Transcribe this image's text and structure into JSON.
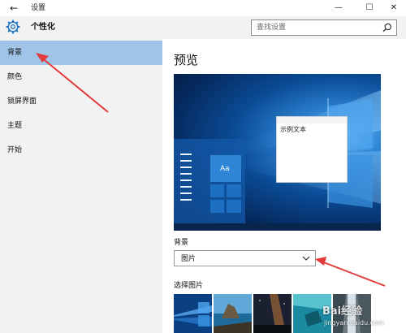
{
  "window": {
    "back_glyph": "←",
    "title": "设置",
    "minimize_glyph": "—",
    "maximize_glyph": "☐",
    "close_glyph": "✕"
  },
  "header": {
    "icon": "gear-icon",
    "title": "个性化",
    "search_placeholder": "查找设置",
    "search_icon": "search-icon"
  },
  "sidebar": {
    "items": [
      {
        "label": "背景",
        "selected": true
      },
      {
        "label": "颜色",
        "selected": false
      },
      {
        "label": "锁屏界面",
        "selected": false
      },
      {
        "label": "主题",
        "selected": false
      },
      {
        "label": "开始",
        "selected": false
      }
    ]
  },
  "main": {
    "preview_title": "预览",
    "preview": {
      "sample_text": "示例文本",
      "tile_text": "Aa"
    },
    "background_label": "背景",
    "background_select": {
      "value": "图片",
      "icon": "chevron-down-icon"
    },
    "choose_picture_label": "选择图片"
  },
  "watermark": {
    "logo": "Bai经验",
    "url": "jingyan.baidu.com"
  },
  "colors": {
    "sidebar_bg": "#f2f2f2",
    "selected_item": "#9fc4e8",
    "wallpaper_blue": "#0b4b96",
    "annotation_arrow": "#e23b3b"
  }
}
